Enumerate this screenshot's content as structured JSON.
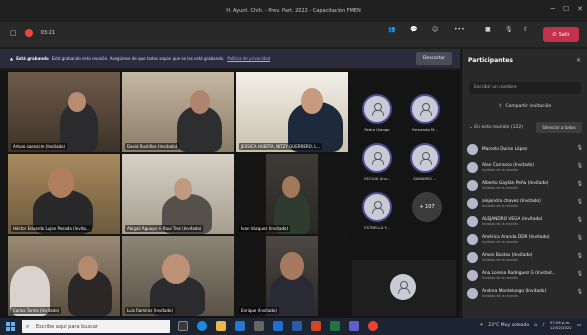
{
  "window": {
    "title": "H. Ayunt. Chih. - Prev. Part. 2022 - Capacitación FMEN"
  },
  "toolbar": {
    "timer": "03:21",
    "chat_icon": "chat-icon",
    "people_icon": "people-icon",
    "leave_label": "Salir"
  },
  "banner": {
    "title": "Está grabando",
    "text": "Está grabando esta reunión. Asegúrese de que todos sepan que se los está grabando.",
    "link": "Política de privacidad",
    "dismiss": "Descartar"
  },
  "tiles": [
    {
      "name": "Arturo saenzcm (Invitado)"
    },
    {
      "name": "David Bustillos (Invitado)"
    },
    {
      "name": "JESSICA HUERTA, NITZY GUERRERO, L..."
    },
    {
      "name": "Héctor Eduardo Lujan Posada (Invita..."
    },
    {
      "name": "Abigail Aguayo + Raul Trez (Invitado)"
    },
    {
      "name": "Ivan Vazquez (Invitado)"
    },
    {
      "name": "Carlos Torres (Invitado)"
    },
    {
      "name": "Luis Ramirez (Invitado)"
    },
    {
      "name": "Enrique (Invitado)"
    }
  ],
  "gallery": [
    {
      "name": "Pedro Ulango"
    },
    {
      "name": "Fernando M..."
    },
    {
      "name": "CECILIA (Inv..."
    },
    {
      "name": "SAMARES ..."
    },
    {
      "name": "ESTRELLA Y..."
    },
    {
      "name": "+ 107"
    }
  ],
  "panel": {
    "title": "Participantes",
    "search_placeholder": "Escribir un nombre",
    "share_label": "Compartir invitación",
    "in_meeting": "En esta reunión (122)",
    "mute_all": "Silenciar a todos",
    "participants": [
      {
        "name": "Marcelo Duran López",
        "role": ""
      },
      {
        "name": "Alan Carrasco (Invitado)",
        "role": "Invitado de la reunión"
      },
      {
        "name": "Alberto Gaytán Peña (Invitado)",
        "role": "Invitado de la reunión"
      },
      {
        "name": "alejandra chavez (Invitado)",
        "role": "Invitado de la reunión"
      },
      {
        "name": "ALEJANDRO VEGA (Invitado)",
        "role": "Invitado de la reunión"
      },
      {
        "name": "América Aranda DDR (Invitado)",
        "role": "Invitado de la reunión"
      },
      {
        "name": "Amon Bustos (Invitado)",
        "role": "Invitado de la reunión"
      },
      {
        "name": "Ana Lorena Rodriguez G (Invitad...",
        "role": "Invitado de la reunión"
      },
      {
        "name": "Andrea Montelongo (Invitado)",
        "role": "Invitado de la reunión"
      }
    ]
  },
  "taskbar": {
    "search_placeholder": "Escribe aquí para buscar",
    "weather": "23°C  Muy soleado",
    "time": "07:06 p.m.",
    "date": "12/02/2022"
  }
}
